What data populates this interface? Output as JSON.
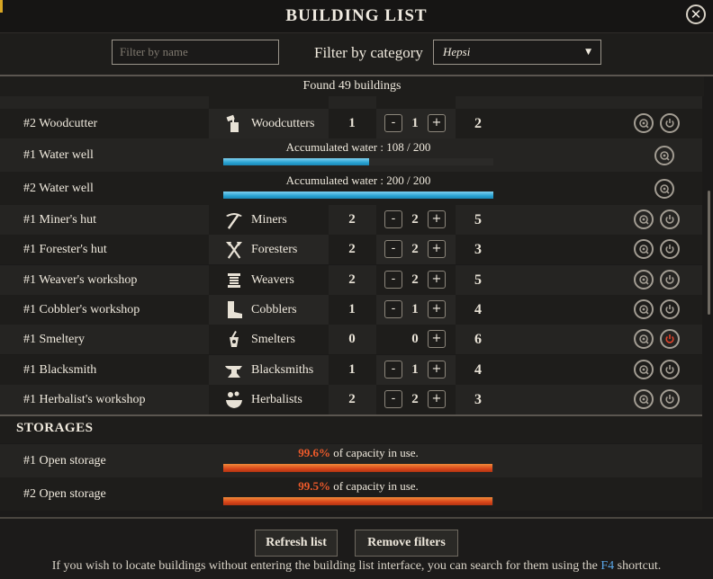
{
  "window": {
    "title": "BUILDING LIST",
    "close_glyph": "✕"
  },
  "filters": {
    "name_placeholder": "Filter by name",
    "category_label": "Filter by category",
    "category_value": "Hepsi"
  },
  "found_text": "Found 49 buildings",
  "rows": [
    {
      "name": "#2 Woodcutter",
      "job": "Woodcutters",
      "icon": "woodcutter-icon",
      "current": "1",
      "assigned": "1",
      "max": "2",
      "has_minus": true,
      "power_active": false
    },
    {
      "name": "#1 Miner's hut",
      "job": "Miners",
      "icon": "pickaxe-icon",
      "current": "2",
      "assigned": "2",
      "max": "5",
      "has_minus": true,
      "power_active": false
    },
    {
      "name": "#1 Forester's hut",
      "job": "Foresters",
      "icon": "crossed-axes-icon",
      "current": "2",
      "assigned": "2",
      "max": "3",
      "has_minus": true,
      "power_active": false
    },
    {
      "name": "#1 Weaver's workshop",
      "job": "Weavers",
      "icon": "spool-icon",
      "current": "2",
      "assigned": "2",
      "max": "5",
      "has_minus": true,
      "power_active": false
    },
    {
      "name": "#1 Cobbler's workshop",
      "job": "Cobblers",
      "icon": "boot-icon",
      "current": "1",
      "assigned": "1",
      "max": "4",
      "has_minus": true,
      "power_active": false
    },
    {
      "name": "#1 Smeltery",
      "job": "Smelters",
      "icon": "crucible-icon",
      "current": "0",
      "assigned": "0",
      "max": "6",
      "has_minus": false,
      "power_active": true
    },
    {
      "name": "#1 Blacksmith",
      "job": "Blacksmiths",
      "icon": "anvil-icon",
      "current": "1",
      "assigned": "1",
      "max": "4",
      "has_minus": true,
      "power_active": false
    },
    {
      "name": "#1 Herbalist's workshop",
      "job": "Herbalists",
      "icon": "mortar-icon",
      "current": "2",
      "assigned": "2",
      "max": "3",
      "has_minus": true,
      "power_active": false
    }
  ],
  "wells": [
    {
      "name": "#1 Water well",
      "label": "Accumulated water : 108 / 200",
      "fraction": 0.54
    },
    {
      "name": "#2 Water well",
      "label": "Accumulated water : 200 / 200",
      "fraction": 1.0
    }
  ],
  "storages_heading": "STORAGES",
  "storages": [
    {
      "name": "#1 Open storage",
      "pct": "99.6%",
      "suffix": "of capacity in use.",
      "fraction": 0.996
    },
    {
      "name": "#2 Open storage",
      "pct": "99.5%",
      "suffix": "of capacity in use.",
      "fraction": 0.995
    }
  ],
  "footer": {
    "refresh_label": "Refresh list",
    "remove_label": "Remove filters",
    "hint_before": "If you wish to locate buildings without entering the building list interface, you can search for them using the ",
    "hint_key": "F4",
    "hint_after": " shortcut."
  },
  "colors": {
    "water": "#2aa3d2",
    "storage": "#d9461a",
    "percent": "#ee5a2a",
    "power_on": "#e0432a",
    "key": "#5aa7e8"
  },
  "stepper": {
    "minus": "-",
    "plus": "+"
  }
}
